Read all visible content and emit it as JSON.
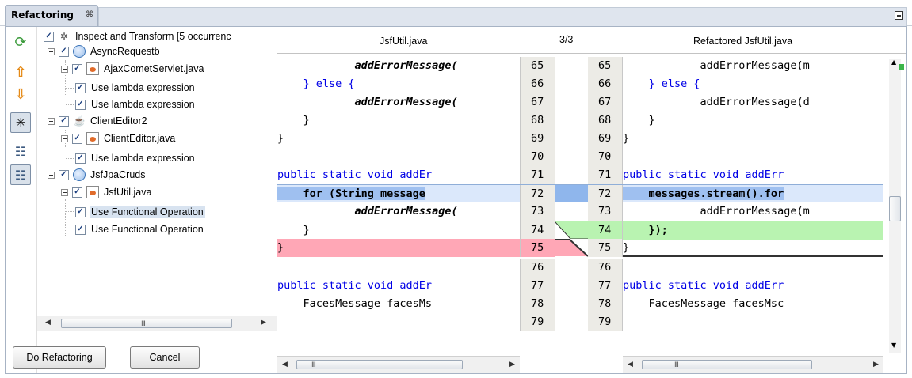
{
  "window": {
    "tab_title": "Refactoring",
    "tab_close_glyph": "⌘"
  },
  "toolbar": {
    "items": [
      {
        "icon": "refresh-icon",
        "glyph": "⟳"
      },
      {
        "icon": "arrow-up-icon",
        "glyph": "⇧"
      },
      {
        "icon": "arrow-down-icon",
        "glyph": "⇩"
      },
      {
        "icon": "collapse-tree-icon",
        "glyph": "✳"
      },
      {
        "icon": "logical-view-icon",
        "glyph": "☷"
      },
      {
        "icon": "physical-view-icon",
        "glyph": "☷"
      }
    ]
  },
  "tree": {
    "root": "Inspect and Transform [5 occurrenc",
    "projects": [
      {
        "name": "AsyncRequestb",
        "file": "AjaxCometServlet.java",
        "items": [
          "Use lambda expression",
          "Use lambda expression"
        ]
      },
      {
        "name": "ClientEditor2",
        "file": "ClientEditor.java",
        "items": [
          "Use lambda expression"
        ]
      },
      {
        "name": "JsfJpaCruds",
        "file": "JsfUtil.java",
        "items": [
          "Use Functional Operation",
          "Use Functional Operation"
        ]
      }
    ],
    "scroll_grip": "III"
  },
  "buttons": {
    "do_refactoring": "Do Refactoring",
    "cancel": "Cancel"
  },
  "diff": {
    "left_title": "JsfUtil.java",
    "counter": "3/3",
    "right_title": "Refactored JsfUtil.java",
    "line_numbers": [
      "65",
      "66",
      "67",
      "68",
      "69",
      "70",
      "71",
      "72",
      "73",
      "74",
      "75",
      "76",
      "77",
      "78",
      "79"
    ],
    "left_lines": [
      "            addErrorMessage(",
      "    } else {",
      "            addErrorMessage(",
      "    }",
      "}",
      "",
      "public static void addEr",
      "    for (String message",
      "            addErrorMessage(",
      "    }",
      "}",
      "",
      "public static void addEr",
      "    FacesMessage facesMs",
      ""
    ],
    "right_lines": [
      "            addErrorMessage(m",
      "    } else {",
      "            addErrorMessage(d",
      "    }",
      "}",
      "",
      "public static void addErr",
      "    messages.stream().for",
      "            addErrorMessage(m",
      "    });",
      "}",
      "",
      "public static void addErr",
      "    FacesMessage facesMsc",
      ""
    ],
    "colors": {
      "changed": "#dbe8fb",
      "changed_strong": "#9fc0f0",
      "added": "#b9f3b1",
      "removed": "#ffa7b6",
      "gutter": "#ecebe6"
    }
  }
}
